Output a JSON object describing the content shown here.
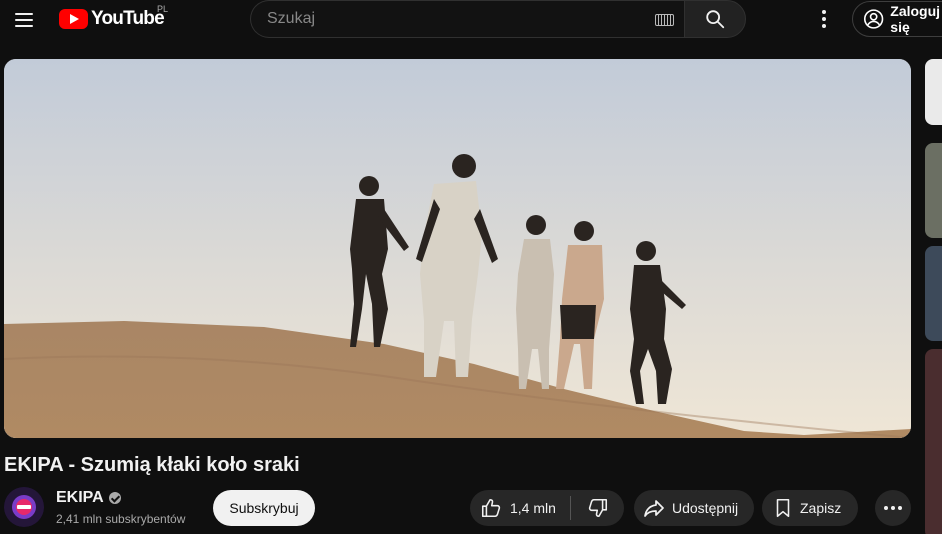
{
  "header": {
    "logo_text": "YouTube",
    "country_code": "PL",
    "search_placeholder": "Szukaj",
    "signin_label": "Zaloguj się"
  },
  "video": {
    "title": "EKIPA - Szumią kłaki koło sraki"
  },
  "channel": {
    "name": "EKIPA",
    "subscribers": "2,41 mln subskrybentów",
    "subscribe_label": "Subskrybuj"
  },
  "actions": {
    "likes": "1,4 mln",
    "share_label": "Udostępnij",
    "save_label": "Zapisz"
  },
  "colors": {
    "brand_red": "#ff0000",
    "background": "#0f0f0f",
    "pill_bg": "#272727"
  },
  "icons": {
    "menu": "menu-icon",
    "search": "search-icon",
    "keyboard": "keyboard-icon",
    "more": "more-vert-icon",
    "account": "account-icon",
    "like": "thumb-up-icon",
    "dislike": "thumb-down-icon",
    "share": "share-icon",
    "save": "bookmark-icon",
    "verified": "verified-icon"
  }
}
